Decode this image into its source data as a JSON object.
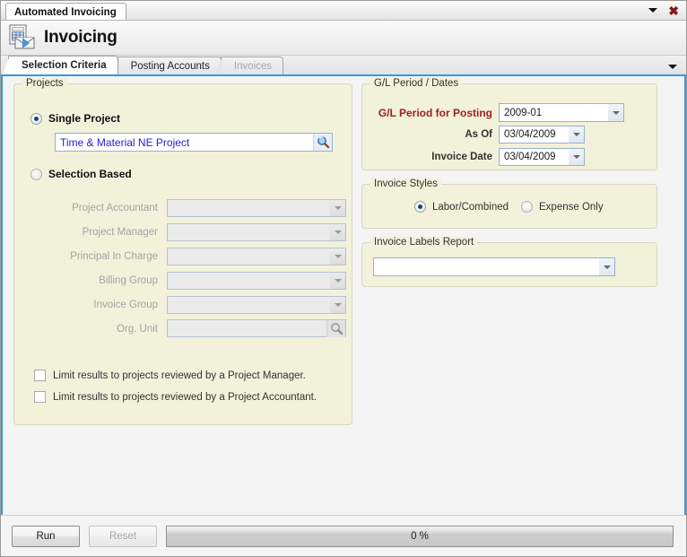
{
  "window": {
    "tab_title": "Automated Invoicing",
    "dropdown_icon": "caret-down-icon",
    "close_icon": "close-icon"
  },
  "header": {
    "title": "Invoicing",
    "icon": "invoice-envelope-icon"
  },
  "tabs": [
    {
      "label": "Selection Criteria",
      "state": "active"
    },
    {
      "label": "Posting Accounts",
      "state": "enabled"
    },
    {
      "label": "Invoices",
      "state": "disabled"
    }
  ],
  "tabstrip": {
    "overflow_icon": "caret-down-icon"
  },
  "projects": {
    "title": "Projects",
    "single_project": {
      "label": "Single Project",
      "selected": true,
      "value": "Time & Material NE Project",
      "lookup_icon": "magnifier-icon"
    },
    "selection_based": {
      "label": "Selection Based",
      "selected": false
    },
    "fields": [
      {
        "label": "Project Accountant",
        "value": "",
        "type": "combo",
        "disabled": true
      },
      {
        "label": "Project Manager",
        "value": "",
        "type": "combo",
        "disabled": true
      },
      {
        "label": "Principal In Charge",
        "value": "",
        "type": "combo",
        "disabled": true
      },
      {
        "label": "Billing Group",
        "value": "",
        "type": "combo",
        "disabled": true
      },
      {
        "label": "Invoice Group",
        "value": "",
        "type": "combo",
        "disabled": true
      },
      {
        "label": "Org. Unit",
        "value": "",
        "type": "lookup",
        "disabled": true,
        "lookup_icon": "magnifier-icon"
      }
    ],
    "checkboxes": [
      {
        "label": "Limit results to projects reviewed by a Project Manager.",
        "checked": false
      },
      {
        "label": "Limit results to projects reviewed by a Project Accountant.",
        "checked": false
      }
    ]
  },
  "gl_period": {
    "title": "G/L Period / Dates",
    "fields": [
      {
        "label": "G/L Period for Posting",
        "value": "2009-01",
        "required": true
      },
      {
        "label": "As Of",
        "value": "03/04/2009",
        "required": false
      },
      {
        "label": "Invoice Date",
        "value": "03/04/2009",
        "required": false
      }
    ]
  },
  "invoice_styles": {
    "title": "Invoice Styles",
    "options": [
      {
        "label": "Labor/Combined",
        "selected": true
      },
      {
        "label": "Expense Only",
        "selected": false
      }
    ]
  },
  "invoice_labels_report": {
    "title": "Invoice Labels Report",
    "value": ""
  },
  "bottom": {
    "run_label": "Run",
    "reset_label": "Reset",
    "reset_disabled": true,
    "progress_text": "0 %",
    "progress_value": 0
  },
  "colors": {
    "panel": "#f2f1da",
    "accent": "#3399e6",
    "required_text": "#9f2020",
    "link_text": "#2222cc",
    "close": "#8d1414"
  }
}
